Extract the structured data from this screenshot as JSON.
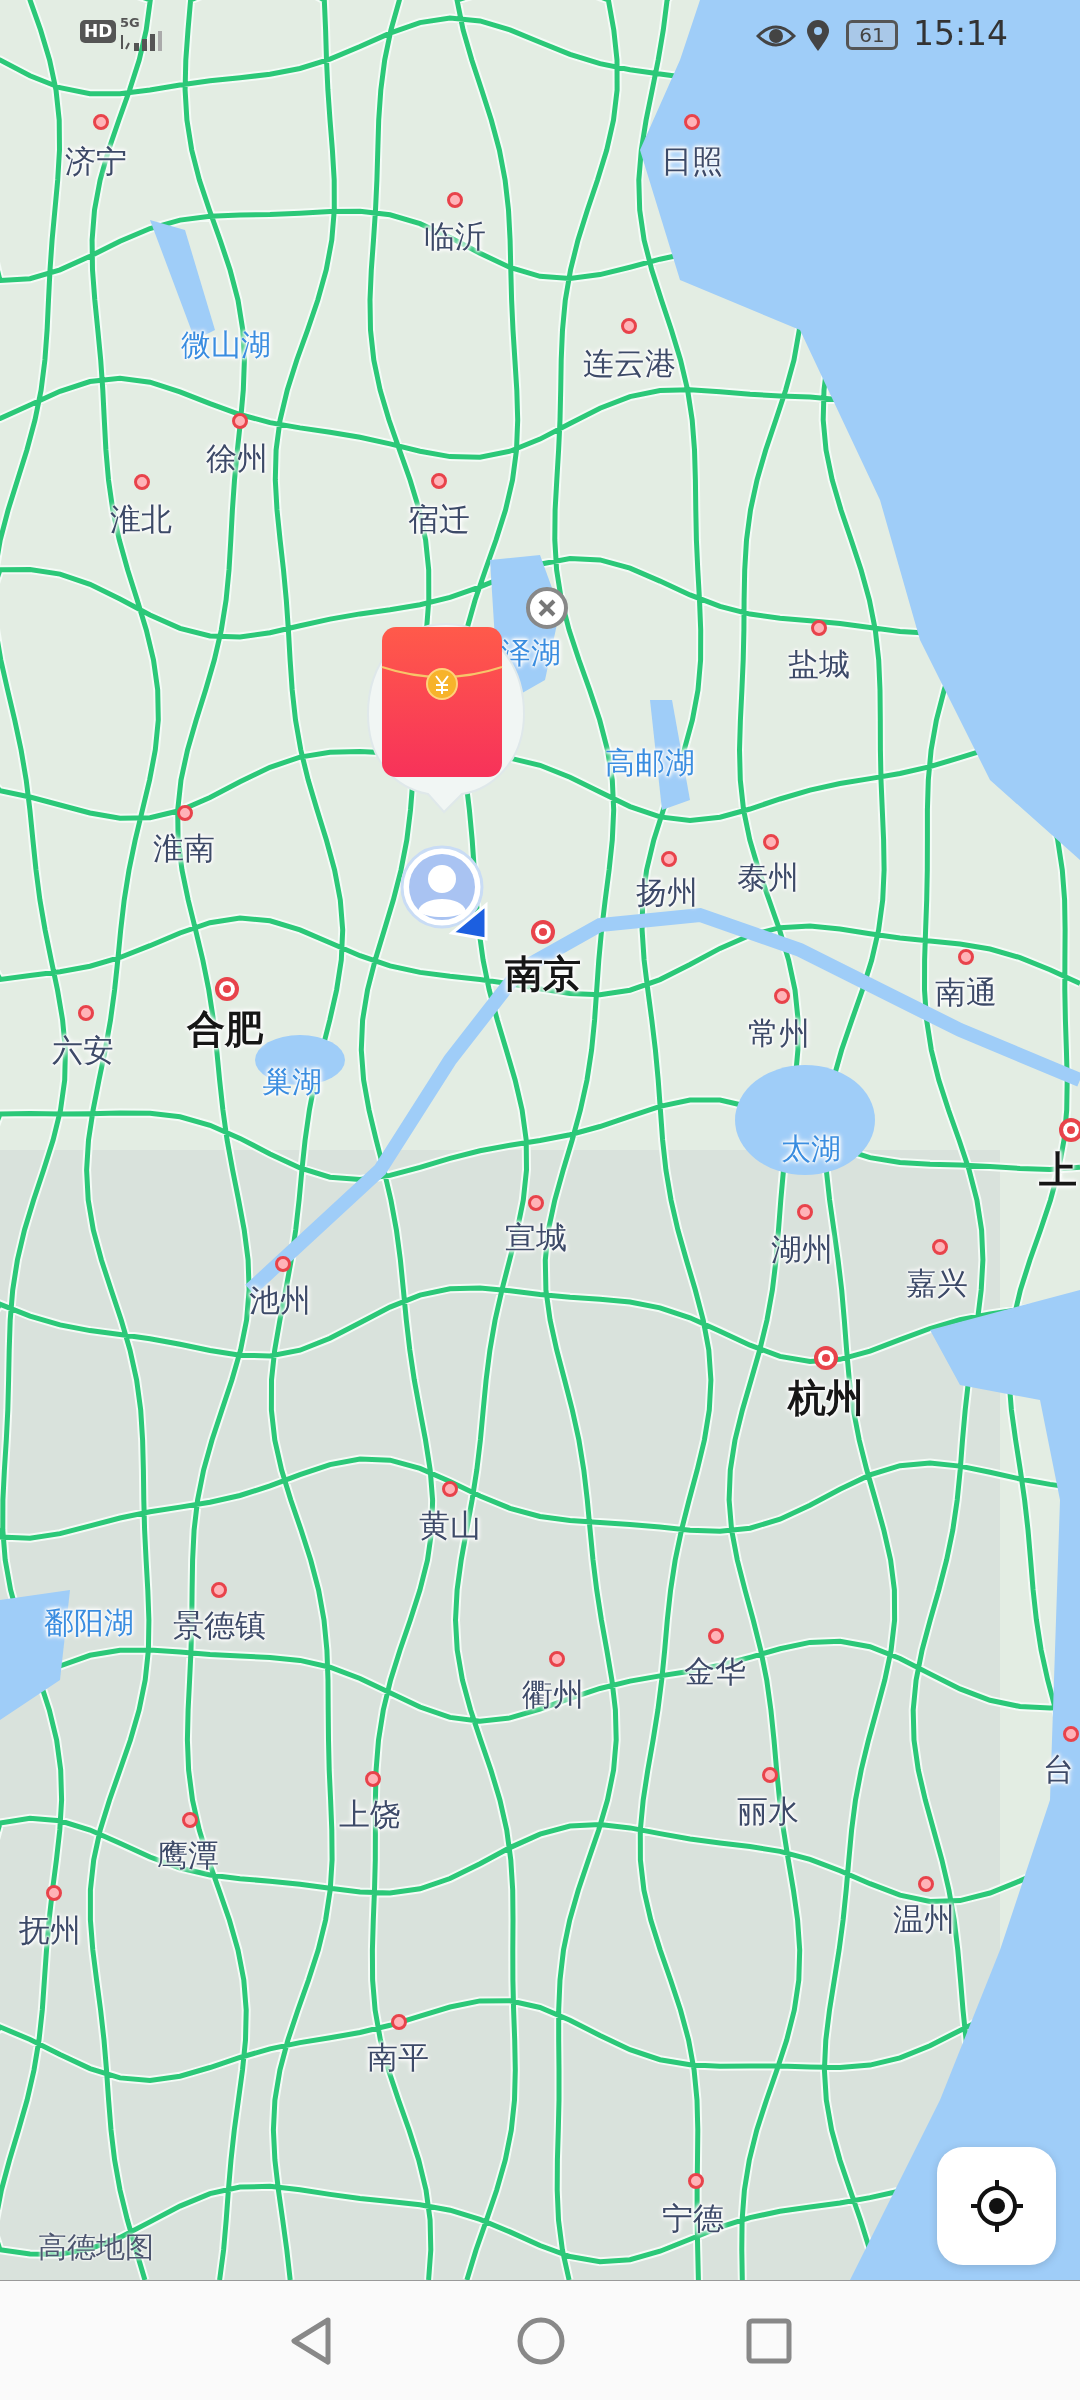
{
  "status_bar": {
    "network_badge": "HD",
    "network_type": "5G",
    "battery": "61",
    "time": "15:14"
  },
  "map": {
    "labels": [
      {
        "text": "济宁",
        "kind": "city"
      },
      {
        "text": "日照",
        "kind": "city"
      },
      {
        "text": "临沂",
        "kind": "city"
      },
      {
        "text": "微山湖",
        "kind": "lake"
      },
      {
        "text": "连云港",
        "kind": "city"
      },
      {
        "text": "徐州",
        "kind": "city"
      },
      {
        "text": "淮北",
        "kind": "city"
      },
      {
        "text": "宿迁",
        "kind": "city"
      },
      {
        "text": "泽湖",
        "kind": "lake"
      },
      {
        "text": "盐城",
        "kind": "city"
      },
      {
        "text": "高邮湖",
        "kind": "lake"
      },
      {
        "text": "淮南",
        "kind": "city"
      },
      {
        "text": "扬州",
        "kind": "city"
      },
      {
        "text": "泰州",
        "kind": "city"
      },
      {
        "text": "南京",
        "kind": "major"
      },
      {
        "text": "南通",
        "kind": "city"
      },
      {
        "text": "合肥",
        "kind": "major"
      },
      {
        "text": "六安",
        "kind": "city"
      },
      {
        "text": "常州",
        "kind": "city"
      },
      {
        "text": "巢湖",
        "kind": "lake"
      },
      {
        "text": "太湖",
        "kind": "lake"
      },
      {
        "text": "上",
        "kind": "major"
      },
      {
        "text": "宣城",
        "kind": "city"
      },
      {
        "text": "湖州",
        "kind": "city"
      },
      {
        "text": "嘉兴",
        "kind": "city"
      },
      {
        "text": "池州",
        "kind": "city"
      },
      {
        "text": "杭州",
        "kind": "major"
      },
      {
        "text": "黄山",
        "kind": "city"
      },
      {
        "text": "鄱阳湖",
        "kind": "lake"
      },
      {
        "text": "景德镇",
        "kind": "city"
      },
      {
        "text": "金华",
        "kind": "city"
      },
      {
        "text": "衢州",
        "kind": "city"
      },
      {
        "text": "台",
        "kind": "city"
      },
      {
        "text": "上饶",
        "kind": "city"
      },
      {
        "text": "丽水",
        "kind": "city"
      },
      {
        "text": "鹰潭",
        "kind": "city"
      },
      {
        "text": "温州",
        "kind": "city"
      },
      {
        "text": "抚州",
        "kind": "city"
      },
      {
        "text": "南平",
        "kind": "city"
      },
      {
        "text": "宁德",
        "kind": "city"
      }
    ],
    "attribution": "高德地图"
  }
}
